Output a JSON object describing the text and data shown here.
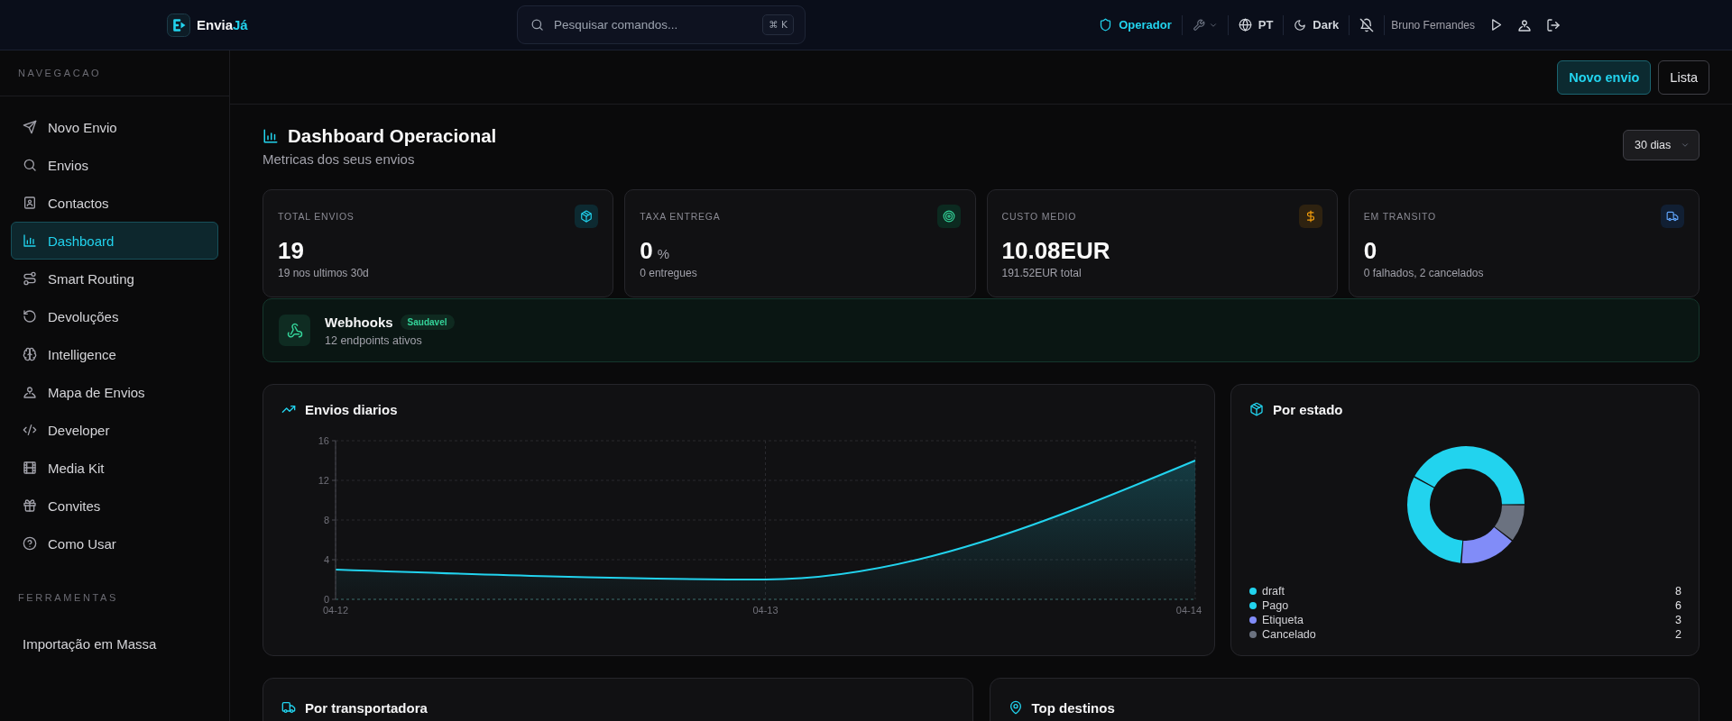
{
  "topbar": {
    "brand": {
      "name": "Envia",
      "accent": "Já"
    },
    "search": {
      "placeholder": "Pesquisar comandos...",
      "shortcut": "⌘ K"
    },
    "role": "Operador",
    "language": "PT",
    "theme": "Dark",
    "user": "Bruno Fernandes"
  },
  "sidebar": {
    "sections": [
      {
        "title": "NAVEGACAO",
        "items": [
          {
            "label": "Novo Envio",
            "selected": false
          },
          {
            "label": "Envios",
            "selected": false
          },
          {
            "label": "Contactos",
            "selected": false
          },
          {
            "label": "Dashboard",
            "selected": true
          },
          {
            "label": "Smart Routing",
            "selected": false
          },
          {
            "label": "Devoluções",
            "selected": false
          },
          {
            "label": "Intelligence",
            "selected": false
          },
          {
            "label": "Mapa de Envios",
            "selected": false
          },
          {
            "label": "Developer",
            "selected": false
          },
          {
            "label": "Media Kit",
            "selected": false
          },
          {
            "label": "Convites",
            "selected": false
          },
          {
            "label": "Como Usar",
            "selected": false
          }
        ]
      },
      {
        "title": "FERRAMENTAS",
        "items": [
          {
            "label": "Importação em Massa",
            "selected": false
          }
        ]
      }
    ]
  },
  "toolbar": {
    "buttons": [
      {
        "label": "Novo envio",
        "kind": "primary"
      },
      {
        "label": "Lista",
        "kind": "outline"
      }
    ]
  },
  "header": {
    "title": "Dashboard Operacional",
    "subtitle": "Metricas dos seus envios",
    "period": "30 dias"
  },
  "stats": [
    {
      "label": "TOTAL ENVIOS",
      "value": "19",
      "sub": "19 nos ultimos 30d"
    },
    {
      "label": "TAXA ENTREGA",
      "value": "0",
      "unit": "%",
      "sub": "0 entregues"
    },
    {
      "label": "CUSTO MEDIO",
      "value": "10.08EUR",
      "sub": "191.52EUR total"
    },
    {
      "label": "EM TRANSITO",
      "value": "0",
      "sub": "0 falhados, 2 cancelados"
    }
  ],
  "webhooks": {
    "title": "Webhooks",
    "status": "Saudavel",
    "detail": "12 endpoints ativos"
  },
  "daily_chart": {
    "title": "Envios diarios",
    "chart_data": {
      "type": "area",
      "categories": [
        "04-12",
        "04-13",
        "04-14"
      ],
      "series": [
        {
          "color": "#22d3ee",
          "values": [
            3,
            2,
            14
          ]
        }
      ],
      "ylim": [
        0,
        16
      ],
      "yticks": [
        0,
        4,
        8,
        12,
        16
      ],
      "grid": true
    }
  },
  "status_chart": {
    "title": "Por estado",
    "chart_data": {
      "type": "donut",
      "values": [
        42.1,
        31.6,
        15.8,
        10.5
      ]
    },
    "legend": [
      {
        "label": "draft",
        "value": "8",
        "color": "#22d3ee"
      },
      {
        "label": "Pago",
        "value": "6",
        "color": "#22d3ee"
      },
      {
        "label": "Etiqueta",
        "value": "3",
        "color": "#818cf8"
      },
      {
        "label": "Cancelado",
        "value": "2",
        "color": "#6b7280"
      }
    ]
  },
  "carriers": {
    "title": "Por transportadora"
  },
  "destinations": {
    "title": "Top destinos"
  }
}
